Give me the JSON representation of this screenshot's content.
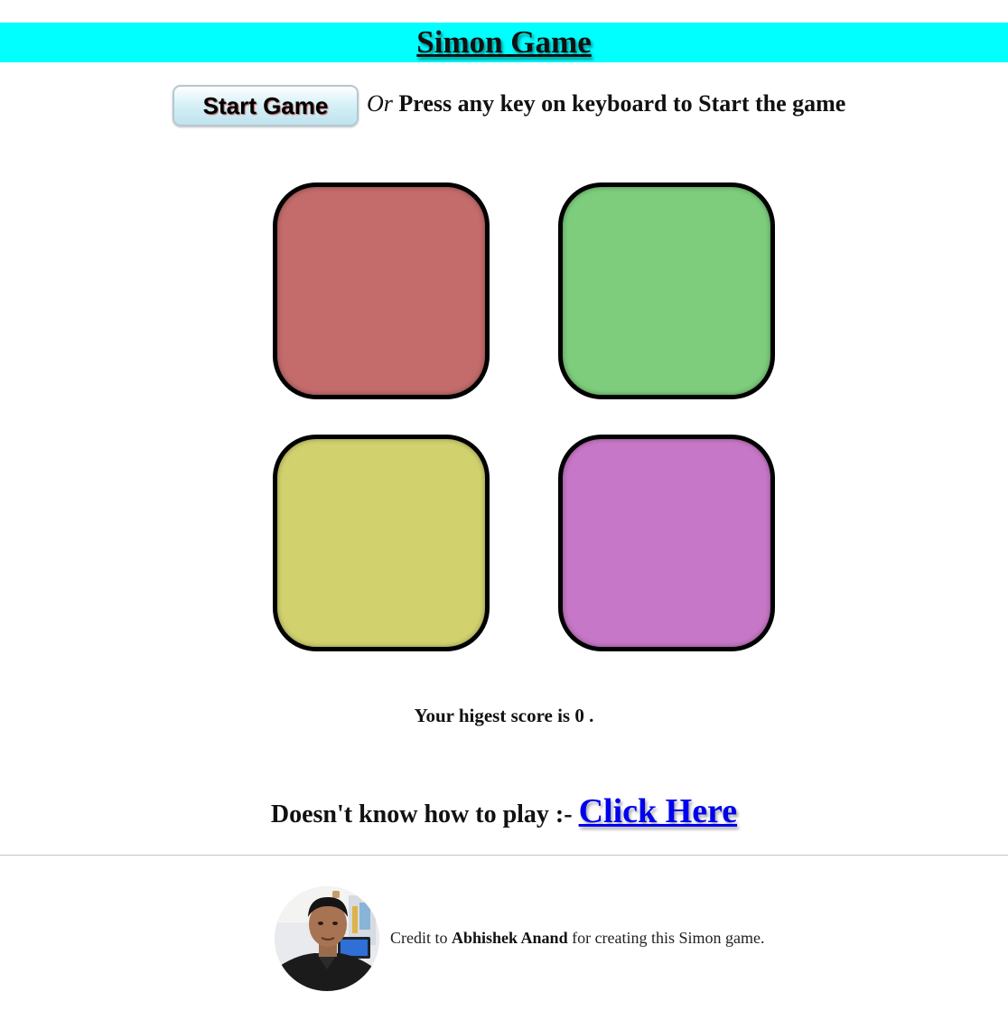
{
  "header": {
    "title": "Simon Game",
    "background_color": "#00ffff"
  },
  "start": {
    "button_label": "Start Game",
    "hint_or": "Or",
    "hint_text": " Press any key on keyboard to Start the game"
  },
  "pads": [
    {
      "color_name": "red",
      "color": "#c46b6b"
    },
    {
      "color_name": "green",
      "color": "#7dcd7c"
    },
    {
      "color_name": "yellow",
      "color": "#d1d26e"
    },
    {
      "color_name": "purple",
      "color": "#c777c7"
    }
  ],
  "score": {
    "prefix": "Your higest score is ",
    "value": "0",
    "suffix": " ."
  },
  "help": {
    "text": "Doesn't know how to play :- ",
    "link_label": "Click Here"
  },
  "footer": {
    "credit_prefix": "Credit to ",
    "author": "Abhishek Anand",
    "credit_suffix": " for creating this Simon game.",
    "avatar_icon": "author-photo"
  }
}
